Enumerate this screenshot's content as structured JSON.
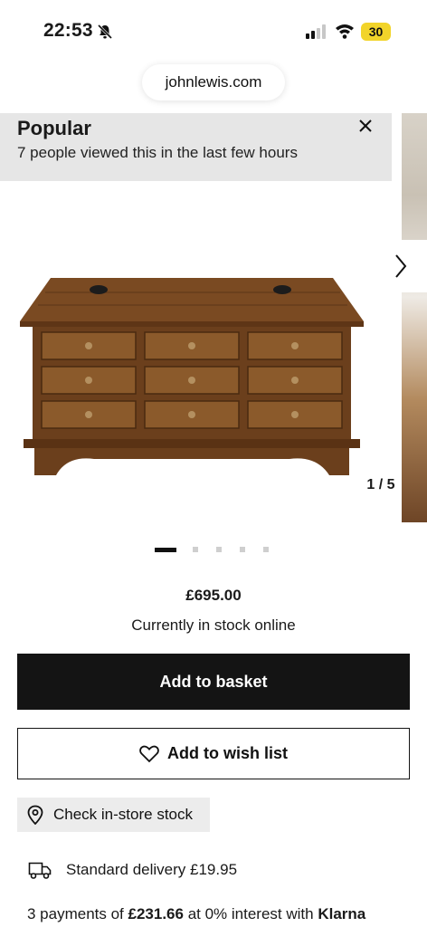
{
  "status_bar": {
    "time": "22:53",
    "battery": "30"
  },
  "browser": {
    "url": "johnlewis.com"
  },
  "popular": {
    "title": "Popular",
    "text": "7 people viewed this in the last few hours"
  },
  "gallery": {
    "counter": "1 / 5",
    "total": 5,
    "active_index": 1
  },
  "product": {
    "price": "£695.00",
    "stock_status": "Currently in stock online"
  },
  "actions": {
    "add_to_basket": "Add to basket",
    "add_to_wish_list": "Add to wish list",
    "check_instore": "Check in-store stock"
  },
  "delivery": {
    "text": "Standard delivery £19.95"
  },
  "klarna": {
    "prefix": "3 payments of ",
    "amount": "£231.66",
    "middle": " at 0% interest with ",
    "brand": "Klarna"
  },
  "colors": {
    "primary_button": "#141414",
    "banner_bg": "#e6e6e6",
    "battery": "#f2d42a"
  },
  "icons": [
    "bell-slash-icon",
    "signal-icon",
    "wifi-icon",
    "close-icon",
    "chevron-right-icon",
    "heart-icon",
    "location-pin-icon",
    "truck-icon"
  ]
}
